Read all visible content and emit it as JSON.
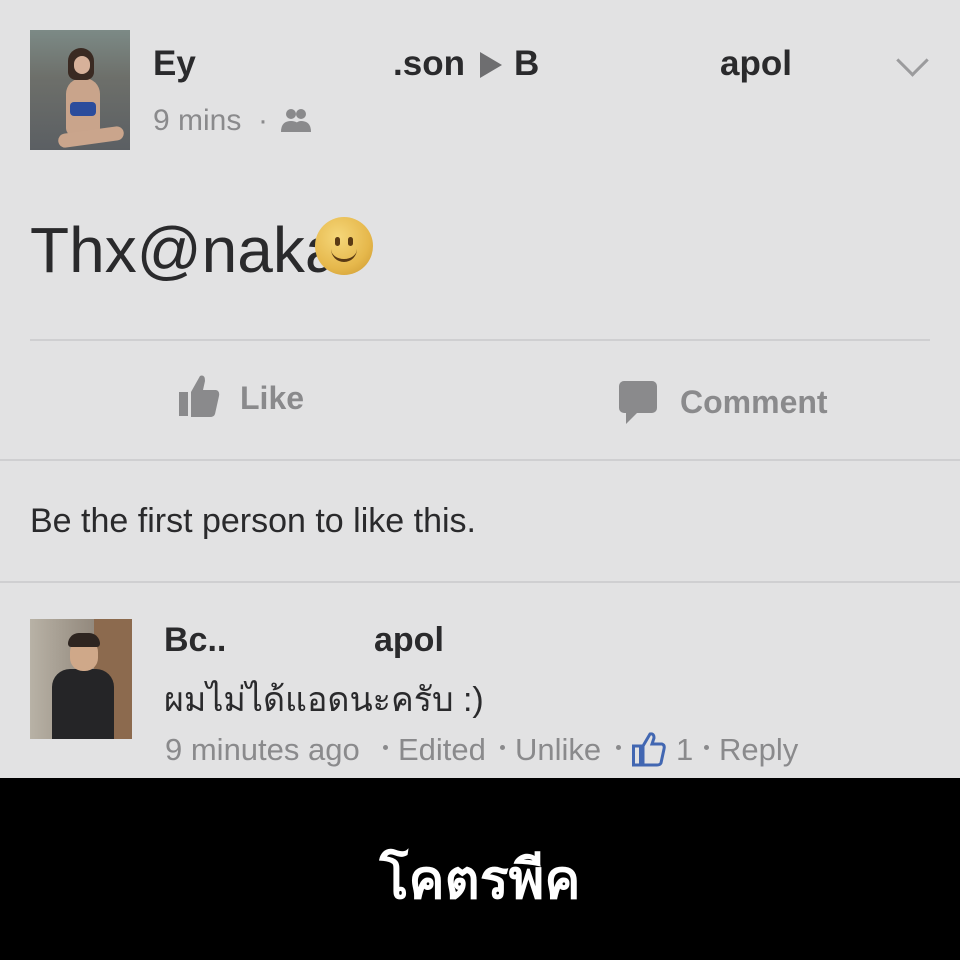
{
  "post": {
    "author_name_parts": [
      "Ey",
      ".son",
      "B",
      "apol"
    ],
    "timestamp": "9 mins",
    "audience_icon": "friends-icon",
    "menu_icon": "chevron-down-icon",
    "text": "Thx@naka",
    "emoji": "slightly-smiling-face"
  },
  "actions": {
    "like_label": "Like",
    "comment_label": "Comment"
  },
  "likes_summary": "Be the first person to like this.",
  "comment": {
    "author_name_parts": [
      "Bc..",
      "apol"
    ],
    "text": "ผมไม่ได้แอดนะครับ :)",
    "time": "9 minutes ago",
    "edited_label": "Edited",
    "unlike_label": "Unlike",
    "like_count": "1",
    "reply_label": "Reply"
  },
  "caption": "โคตรพีค",
  "colors": {
    "background": "#e2e2e3",
    "text": "#2a2a2c",
    "muted_text": "#8a8a8c",
    "like_blue": "#4267b2",
    "caption_bar": "#000000"
  }
}
